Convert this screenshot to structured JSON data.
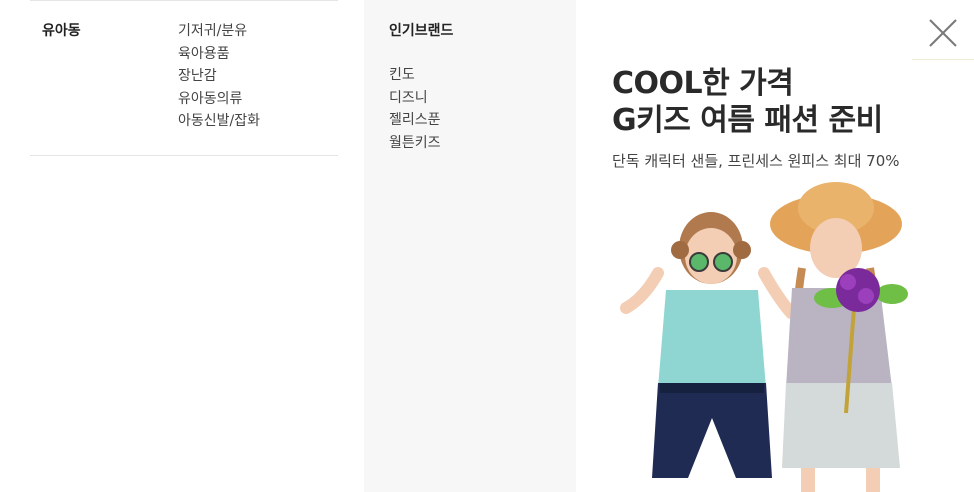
{
  "category": {
    "title": "유아동",
    "items": [
      "기저귀/분유",
      "육아용품",
      "장난감",
      "유아동의류",
      "아동신발/잡화"
    ]
  },
  "brands": {
    "title": "인기브랜드",
    "items": [
      "킨도",
      "디즈니",
      "젤리스푼",
      "월튼키즈"
    ]
  },
  "banner": {
    "headline1": "COOL한 가격",
    "headline2": "G키즈 여름 패션 준비",
    "subtitle": "단독 캐릭터 샌들, 프린세스 원피스 최대 70%"
  },
  "icons": {
    "close": "close-icon"
  },
  "colors": {
    "mid_panel_bg": "#f7f7f7",
    "text_dark": "#222222",
    "divider": "#e6e6e6"
  }
}
